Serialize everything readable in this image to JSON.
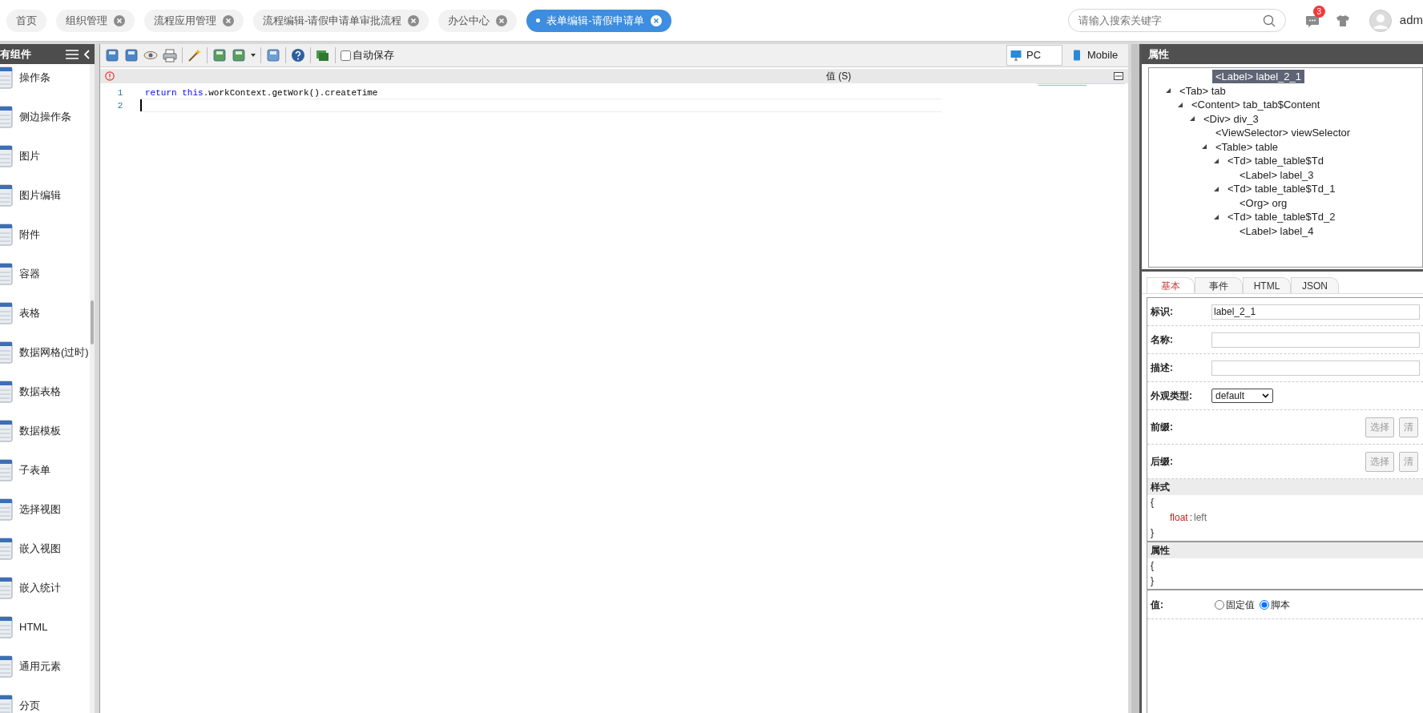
{
  "top_tabs": [
    {
      "label": "首页",
      "closable": false,
      "selected": false
    },
    {
      "label": "组织管理",
      "closable": true,
      "selected": false
    },
    {
      "label": "流程应用管理",
      "closable": true,
      "selected": false
    },
    {
      "label": "流程编辑-请假申请单审批流程",
      "closable": true,
      "selected": false
    },
    {
      "label": "办公中心",
      "closable": true,
      "selected": false
    },
    {
      "label": "表单编辑-请假申请单",
      "closable": true,
      "selected": true
    }
  ],
  "search": {
    "placeholder": "请输入搜索关键字"
  },
  "notifications": {
    "badge": "3"
  },
  "user": {
    "name": "adm"
  },
  "components_panel": {
    "title": "有组件",
    "items": [
      "操作条",
      "侧边操作条",
      "图片",
      "图片编辑",
      "附件",
      "容器",
      "表格",
      "数据网格(过时)",
      "数据表格",
      "数据模板",
      "子表单",
      "选择视图",
      "嵌入视图",
      "嵌入统计",
      "HTML",
      "通用元素",
      "分页"
    ]
  },
  "toolbar": {
    "autosave": {
      "label": "自动保存",
      "checked": false
    },
    "views": [
      {
        "label": "PC",
        "selected": true
      },
      {
        "label": "Mobile",
        "selected": false
      }
    ]
  },
  "editor": {
    "title": "值 (S)",
    "lines": [
      {
        "number": "1",
        "tokens": [
          {
            "text": "return",
            "kind": "keyword"
          },
          {
            "text": " this",
            "kind": "keyword"
          },
          {
            "text": ".workContext.getWork().createTime",
            "kind": "plain"
          }
        ]
      },
      {
        "number": "2"
      }
    ]
  },
  "properties": {
    "title": "属性",
    "tree": [
      {
        "label": "<Label> label_2_1",
        "selected": true
      },
      {
        "label": "<Tab> tab",
        "selected": false,
        "expanded": true,
        "children": [
          {
            "label": "<Content> tab_tab$Content",
            "selected": false,
            "expanded": true,
            "children": [
              {
                "label": "<Div> div_3",
                "selected": false,
                "expanded": true,
                "children": [
                  {
                    "label": "<ViewSelector> viewSelector",
                    "selected": false
                  },
                  {
                    "label": "<Table> table",
                    "selected": false,
                    "expanded": true,
                    "children": [
                      {
                        "label": "<Td> table_table$Td",
                        "selected": false,
                        "expanded": true,
                        "children": [
                          {
                            "label": "<Label> label_3",
                            "selected": false
                          }
                        ]
                      },
                      {
                        "label": "<Td> table_table$Td_1",
                        "selected": false,
                        "expanded": true,
                        "children": [
                          {
                            "label": "<Org> org",
                            "selected": false
                          }
                        ]
                      },
                      {
                        "label": "<Td> table_table$Td_2",
                        "selected": false,
                        "expanded": true,
                        "children": [
                          {
                            "label": "<Label> label_4",
                            "selected": false
                          }
                        ]
                      }
                    ]
                  }
                ]
              }
            ]
          }
        ]
      }
    ],
    "tabs": [
      {
        "label": "基本",
        "selected": true
      },
      {
        "label": "事件",
        "selected": false
      },
      {
        "label": "HTML",
        "selected": false
      },
      {
        "label": "JSON",
        "selected": false
      }
    ],
    "fields": [
      {
        "kind": "input",
        "label": "标识:",
        "value": "label_2_1"
      },
      {
        "kind": "input",
        "label": "名称:"
      },
      {
        "kind": "input",
        "label": "描述:"
      },
      {
        "kind": "select",
        "label": "外观类型:",
        "value": "default"
      },
      {
        "kind": "buttons",
        "label": "前缀:",
        "buttons": [
          "选择",
          "清"
        ]
      },
      {
        "kind": "buttons",
        "label": "后缀:",
        "buttons": [
          "选择",
          "清"
        ]
      }
    ],
    "style_section": {
      "title": "样式",
      "open": "{",
      "entries": [
        {
          "key": "float",
          "separator": ":",
          "value": "left"
        }
      ],
      "close": "}"
    },
    "attr_section": {
      "title": "属性",
      "open": "{",
      "close": "}"
    },
    "value_row": {
      "label": "值:",
      "options": [
        {
          "label": "固定值",
          "selected": false
        },
        {
          "label": "脚本",
          "selected": true
        }
      ]
    }
  }
}
